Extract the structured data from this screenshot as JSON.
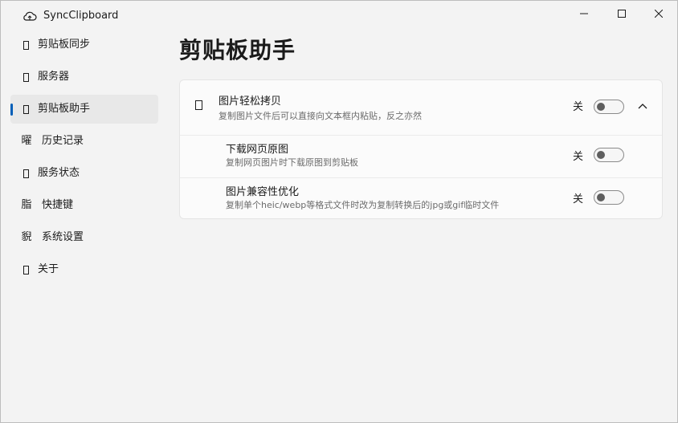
{
  "window": {
    "title": "SyncClipboard",
    "icon": "cloud-sync-icon"
  },
  "sidebar": {
    "items": [
      {
        "label": "剪贴板同步",
        "icon": "clipboard-sync-icon",
        "glyph": ""
      },
      {
        "label": "服务器",
        "icon": "server-icon",
        "glyph": ""
      },
      {
        "label": "剪贴板助手",
        "icon": "clipboard-assistant-icon",
        "glyph": "",
        "selected": true
      },
      {
        "label": "历史记录",
        "icon": "history-icon",
        "glyph": "曜"
      },
      {
        "label": "服务状态",
        "icon": "service-status-icon",
        "glyph": ""
      },
      {
        "label": "快捷键",
        "icon": "keyboard-icon",
        "glyph": "脂"
      },
      {
        "label": "系统设置",
        "icon": "settings-icon",
        "glyph": "貎"
      },
      {
        "label": "关于",
        "icon": "info-icon",
        "glyph": ""
      }
    ]
  },
  "page": {
    "title": "剪贴板助手"
  },
  "settings": {
    "expander": {
      "title": "图片轻松拷贝",
      "description": "复制图片文件后可以直接向文本框内粘贴，反之亦然",
      "state_label": "关",
      "on": false,
      "icon": "image-copy-icon"
    },
    "children": [
      {
        "title": "下载网页原图",
        "description": "复制网页图片时下载原图到剪贴板",
        "state_label": "关",
        "on": false
      },
      {
        "title": "图片兼容性优化",
        "description": "复制单个heic/webp等格式文件时改为复制转换后的jpg或gif临时文件",
        "state_label": "关",
        "on": false
      }
    ]
  },
  "colors": {
    "accent": "#005fb8",
    "background": "#f3f3f3",
    "card": "#fbfbfb"
  }
}
